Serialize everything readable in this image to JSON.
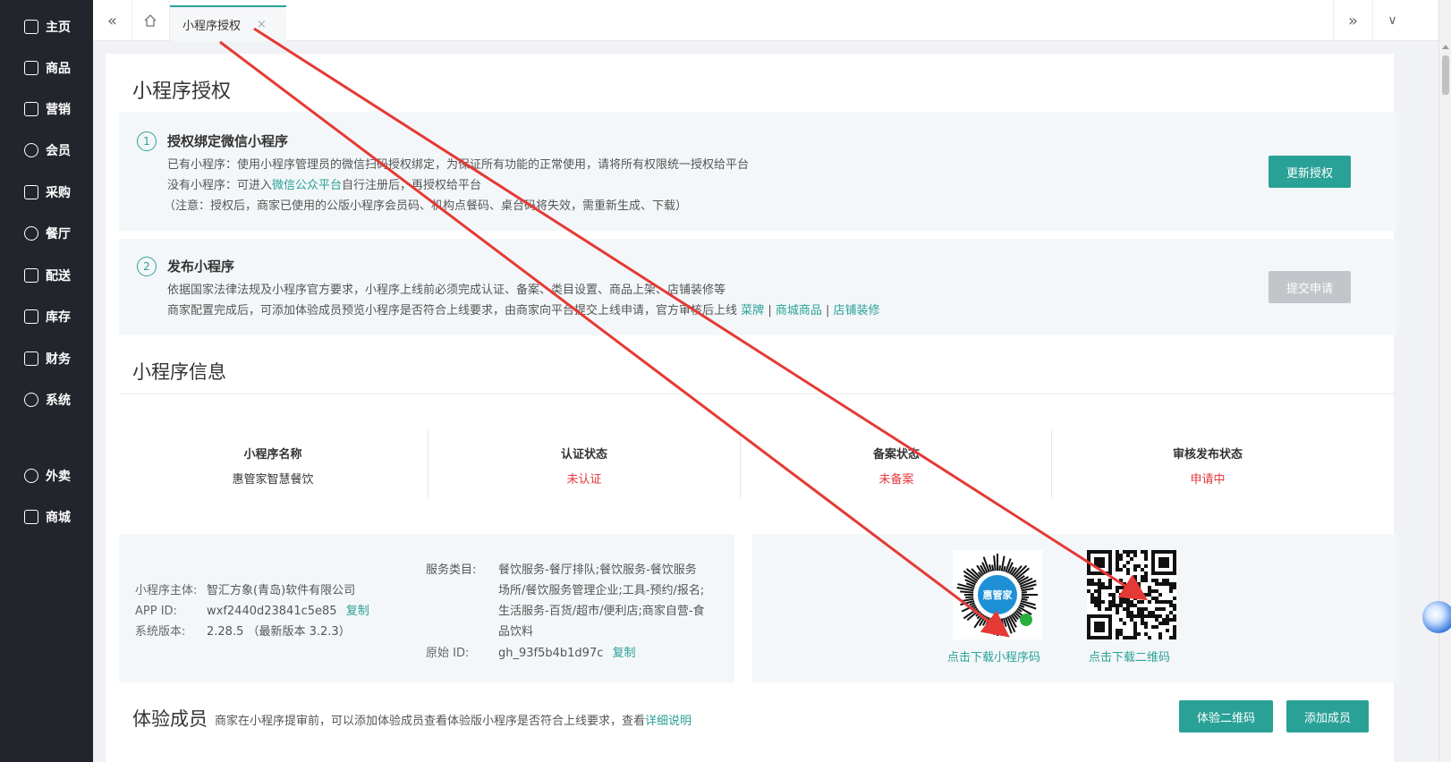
{
  "sidebar": {
    "items": [
      {
        "label": "主页",
        "icon": "home-icon"
      },
      {
        "label": "商品",
        "icon": "box-icon"
      },
      {
        "label": "营销",
        "icon": "chart-icon"
      },
      {
        "label": "会员",
        "icon": "heart-icon"
      },
      {
        "label": "采购",
        "icon": "cart-icon"
      },
      {
        "label": "餐厅",
        "icon": "bell-icon"
      },
      {
        "label": "配送",
        "icon": "store-icon"
      },
      {
        "label": "库存",
        "icon": "folder-icon"
      },
      {
        "label": "财务",
        "icon": "wallet-icon"
      },
      {
        "label": "系统",
        "icon": "gear-icon"
      },
      {
        "label": "外卖",
        "icon": "bike-icon"
      },
      {
        "label": "商城",
        "icon": "shop-icon"
      }
    ]
  },
  "topbar": {
    "prev_glyph": "«",
    "home_icon": "home-icon",
    "active_tab": "小程序授权",
    "close_glyph": "×",
    "next_glyph": "»",
    "dropdown_glyph": "∨"
  },
  "page": {
    "title": "小程序授权",
    "step1": {
      "num": "1",
      "title": "授权绑定微信小程序",
      "line1": "已有小程序：使用小程序管理员的微信扫码授权绑定，为保证所有功能的正常使用，请将所有权限统一授权给平台",
      "line2_prefix": "没有小程序：可进入",
      "line2_link": "微信公众平台",
      "line2_suffix": "自行注册后，再授权给平台",
      "line3": "（注意：授权后，商家已使用的公版小程序会员码、机构点餐码、桌台码将失效，需重新生成、下载）",
      "button": "更新授权"
    },
    "step2": {
      "num": "2",
      "title": "发布小程序",
      "line1": "依据国家法律法规及小程序官方要求，小程序上线前必须完成认证、备案、类目设置、商品上架、店铺装修等",
      "line2_prefix": "商家配置完成后，可添加体验成员预览小程序是否符合上线要求，由商家向平台提交上线申请，官方审核后上线",
      "link1": "菜牌",
      "sep": "|",
      "link2": "商城商品",
      "link3": "店铺装修",
      "button": "提交申请"
    },
    "info_title": "小程序信息",
    "stats": [
      {
        "label": "小程序名称",
        "value": "惠管家智慧餐饮",
        "red": false
      },
      {
        "label": "认证状态",
        "value": "未认证",
        "red": true
      },
      {
        "label": "备案状态",
        "value": "未备案",
        "red": true
      },
      {
        "label": "审核发布状态",
        "value": "申请中",
        "red": true
      }
    ],
    "details": {
      "subject_key": "小程序主体:",
      "subject_val": "智汇方象(青岛)软件有限公司",
      "appid_key": "APP ID:",
      "appid_val": "wxf2440d23841c5e85",
      "copy": "复制",
      "version_key": "系统版本:",
      "version_val": "2.28.5 （最新版本 3.2.3）",
      "category_key": "服务类目:",
      "category_lines": [
        "餐饮服务-餐厅排队;餐饮服务-餐饮服务",
        "场所/餐饮服务管理企业;工具-预约/报名;",
        "生活服务-百货/超市/便利店;商家自营-食",
        "品饮料"
      ],
      "origin_key": "原始 ID:",
      "origin_val": "gh_93f5b4b1d97c",
      "copy2": "复制"
    },
    "qr": {
      "mini_caption": "点击下载小程序码",
      "mini_brand": "惠管家",
      "qr_caption": "点击下载二维码"
    },
    "members": {
      "title": "体验成员",
      "desc_prefix": "商家在小程序提审前，可以添加体验成员查看体验版小程序是否符合上线要求，查看",
      "desc_link": "详细说明",
      "btn_qr": "体验二维码",
      "btn_add": "添加成员"
    }
  },
  "colors": {
    "accent": "#2aa197",
    "sidebar": "#22252c",
    "red": "#e4393c",
    "annotation": "#e53935"
  }
}
